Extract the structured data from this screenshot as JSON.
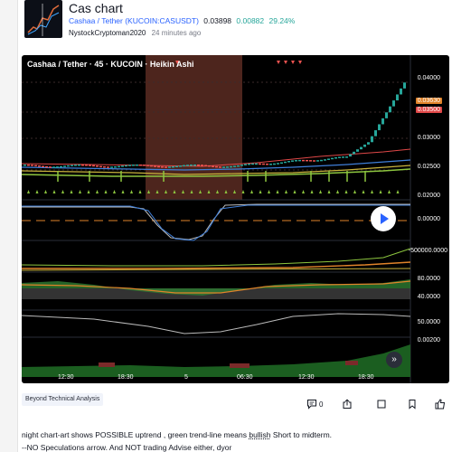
{
  "idea": {
    "title": "Cas chart",
    "symbol_link": "Cashaa / Tether (KUCOIN:CASUSDT)",
    "price": "0.03898",
    "change": "0.00882",
    "change_pct": "29.24%",
    "author": "NystockCryptoman2020",
    "published": "24 minutes ago"
  },
  "chart": {
    "legend": "Cashaa / Tether · 45 · KUCOIN · Heikin Ashi",
    "price_ticks": [
      "0.04000",
      "0.03500",
      "0.03000",
      "0.02500",
      "0.02000"
    ],
    "price_tag_1": "0.03630",
    "price_tag_2": "0.03500",
    "osc1_tick": "0.00000",
    "osc2_tick": "-500000.0000",
    "osc3_ticks": [
      "80.0000",
      "40.0000"
    ],
    "osc4_ticks": [
      "50.0000"
    ],
    "osc5_tick": "0.00200",
    "time_labels": [
      "12:30",
      "18:30",
      "5",
      "06:30",
      "12:30",
      "18:30"
    ],
    "colors": {
      "bull": "#26a69a",
      "bear": "#ef5350",
      "highlight": "#8b3a3a"
    }
  },
  "tags": [
    "Beyond Technical Analysis"
  ],
  "actions": {
    "comments_count": "0"
  },
  "description": {
    "line1_a": "night chart-art shows POSSIBLE  uptrend , green trend-line means ",
    "line1_u": "bullish",
    "line1_b": " Short to midterm.",
    "line2": "--NO Speculations arrow. And NOT trading Advise either, dyor"
  }
}
